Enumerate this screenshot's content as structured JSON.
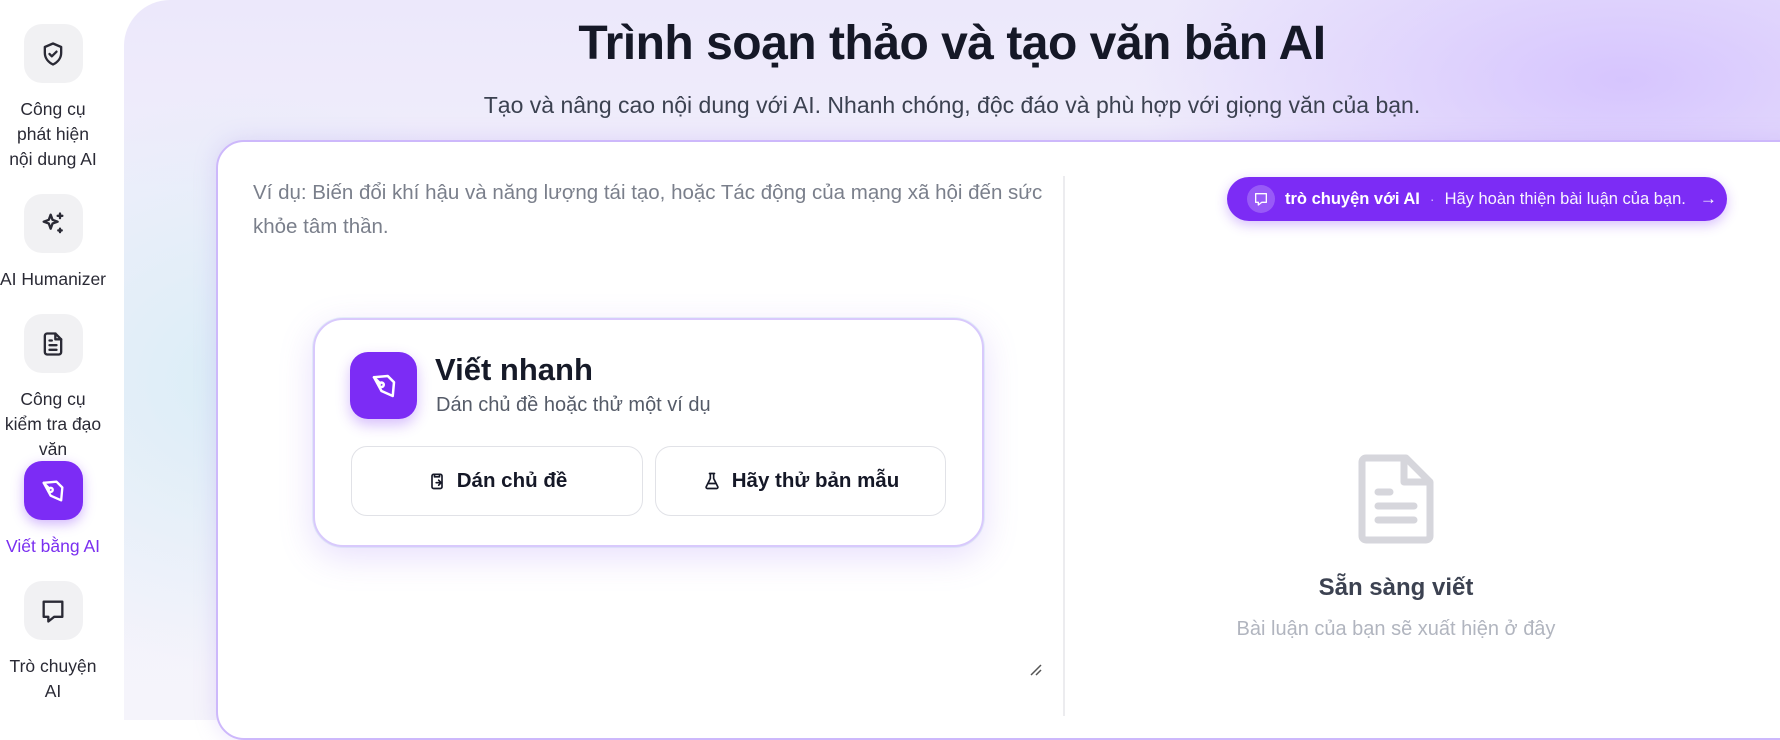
{
  "sidebar": {
    "items": [
      {
        "label": "Công cụ phát hiện nội dung AI",
        "icon": "shield-check-icon",
        "active": false
      },
      {
        "label": "AI Humanizer",
        "icon": "sparkle-icon",
        "active": false
      },
      {
        "label": "Công cụ kiểm tra đạo văn",
        "icon": "document-icon",
        "active": false
      },
      {
        "label": "Viết bằng AI",
        "icon": "pen-tool-icon",
        "active": true
      },
      {
        "label": "Trò chuyện AI",
        "icon": "chat-bubble-icon",
        "active": false
      }
    ]
  },
  "header": {
    "title": "Trình soạn thảo và tạo văn bản AI",
    "subtitle": "Tạo và nâng cao nội dung với AI. Nhanh chóng, độc đáo và phù hợp với giọng văn của bạn."
  },
  "editor": {
    "placeholder": "Ví dụ: Biến đổi khí hậu và năng lượng tái tạo, hoặc Tác động của mạng xã hội đến sức khỏe tâm thần."
  },
  "quick_write": {
    "title": "Viết nhanh",
    "subtitle": "Dán chủ đề hoặc thử một ví dụ",
    "paste_button": "Dán chủ đề",
    "sample_button": "Hãy thử bản mẫu"
  },
  "chat_pill": {
    "strong": "trò chuyện với AI",
    "separator": "·",
    "hint": "Hãy hoàn thiện bài luận của bạn.",
    "arrow": "→"
  },
  "output": {
    "title": "Sẵn sàng viết",
    "subtitle": "Bài luận của bạn sẽ xuất hiện ở đây"
  },
  "colors": {
    "accent": "#7c2cf5",
    "active_label": "#7a2ff0",
    "border": "#cdb8fb"
  }
}
